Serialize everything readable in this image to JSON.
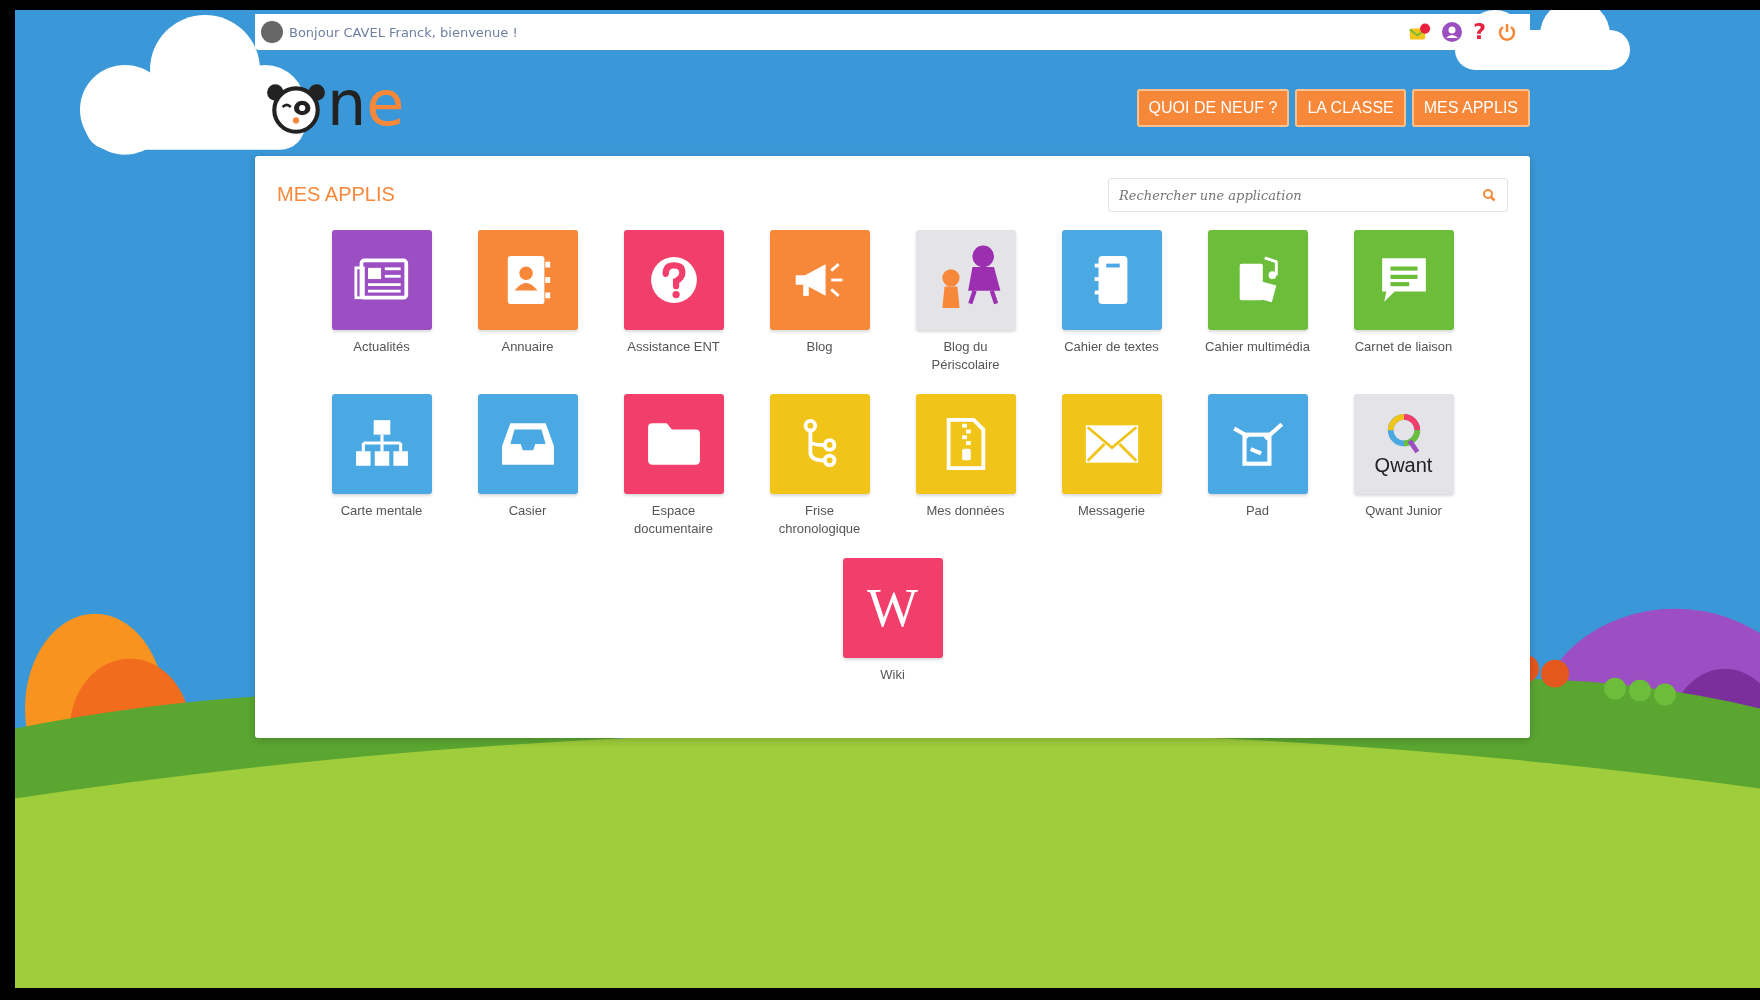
{
  "top_bar": {
    "greeting": "Bonjour CAVEL Franck, bienvenue !",
    "help_icon": "?"
  },
  "logo": {
    "text": "ne"
  },
  "nav": [
    "QUOI DE NEUF ?",
    "LA CLASSE",
    "MES APPLIS"
  ],
  "panel": {
    "title": "MES APPLIS",
    "search": {
      "placeholder": "Rechercher une application"
    }
  },
  "apps": [
    {
      "label": "Actualités",
      "kind": "newspaper",
      "color": "#9b4fc2"
    },
    {
      "label": "Annuaire",
      "kind": "contacts",
      "color": "#f7883a"
    },
    {
      "label": "Assistance ENT",
      "kind": "help",
      "color": "#f23e6b"
    },
    {
      "label": "Blog",
      "kind": "megaphone",
      "color": "#f7883a"
    },
    {
      "label": "Blog du Périscolaire",
      "kind": "picture",
      "color": "#e4e4e8"
    },
    {
      "label": "Cahier de textes",
      "kind": "notebook",
      "color": "#4aa8e2"
    },
    {
      "label": "Cahier multimédia",
      "kind": "music",
      "color": "#6cbd3a"
    },
    {
      "label": "Carnet de liaison",
      "kind": "chat",
      "color": "#6cbd3a"
    },
    {
      "label": "Carte mentale",
      "kind": "sitemap",
      "color": "#4aa8e2"
    },
    {
      "label": "Casier",
      "kind": "inbox",
      "color": "#4aa8e2"
    },
    {
      "label": "Espace documentaire",
      "kind": "folder",
      "color": "#f23e6b"
    },
    {
      "label": "Frise chronologique",
      "kind": "branch",
      "color": "#f0c419"
    },
    {
      "label": "Mes données",
      "kind": "zip",
      "color": "#f0c419"
    },
    {
      "label": "Messagerie",
      "kind": "mail",
      "color": "#f0c419"
    },
    {
      "label": "Pad",
      "kind": "pad",
      "color": "#4aa8e2"
    },
    {
      "label": "Qwant Junior",
      "kind": "qwant",
      "color": "#e4e4e8",
      "logo_text": "Qwant"
    },
    {
      "label": "Wiki",
      "kind": "wiki",
      "color": "#f23e6b",
      "glyph": "W"
    }
  ]
}
